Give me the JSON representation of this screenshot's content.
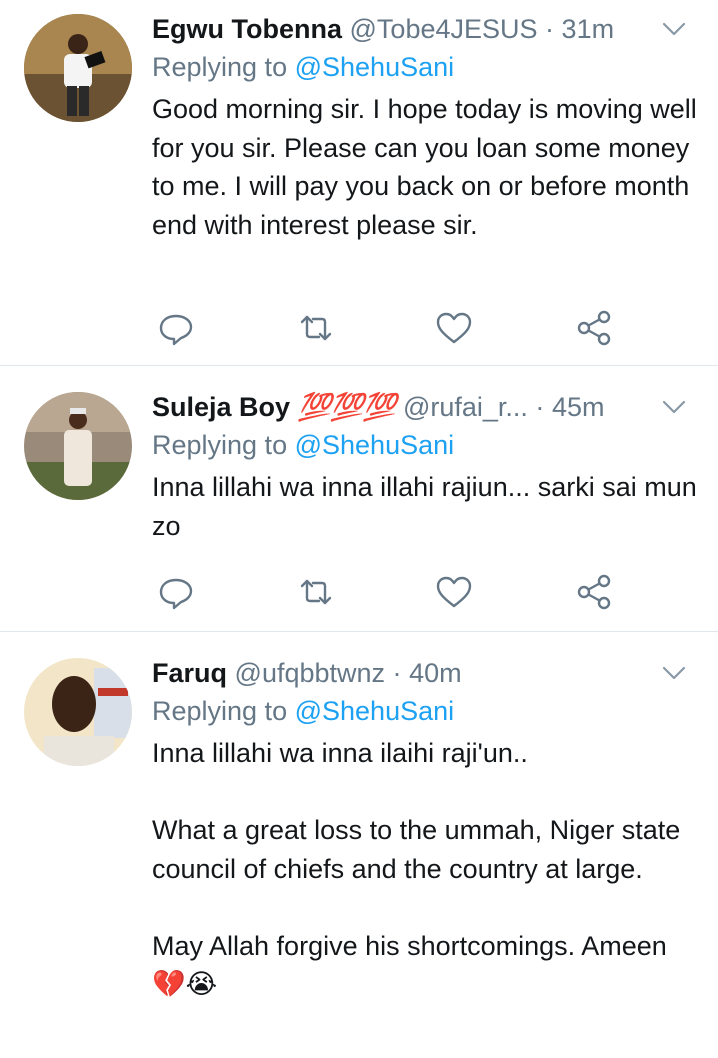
{
  "tweets": [
    {
      "name": "Egwu Tobenna",
      "handle": "@Tobe4JESUS",
      "time": "31m",
      "replying_label": "Replying to",
      "replying_to": "@ShehuSani",
      "text": "Good morning sir. I hope today is moving well for you sir. Please can you loan some money to me. I will pay you back on or before month end with interest please sir.",
      "avatar_icon": "man-in-white-shirt-photo"
    },
    {
      "name": "Suleja Boy",
      "name_emoji": "💯💯💯",
      "handle": "@rufai_r...",
      "time": "45m",
      "replying_label": "Replying to",
      "replying_to": "@ShehuSani",
      "text": "Inna lillahi wa inna illahi rajiun... sarki sai mun zo",
      "avatar_icon": "man-in-white-kaftan-photo"
    },
    {
      "name": "Faruq",
      "handle": "@ufqbbtwnz",
      "time": "40m",
      "replying_label": "Replying to",
      "replying_to": "@ShehuSani",
      "text": "Inna lillahi wa inna ilaihi raji'un..\n\nWhat a great loss to the ummah, Niger state council of chiefs and the country at large.\n\nMay Allah forgive his shortcomings. Ameen💔😭",
      "avatar_icon": "man-selfie-photo"
    }
  ],
  "separator": "·",
  "icons": [
    "reply-icon",
    "retweet-icon",
    "like-icon",
    "share-icon",
    "chevron-down-icon"
  ],
  "colors": {
    "link": "#1da1f2",
    "secondary": "#657786",
    "text": "#14171a",
    "divider": "#e1e8ed"
  }
}
